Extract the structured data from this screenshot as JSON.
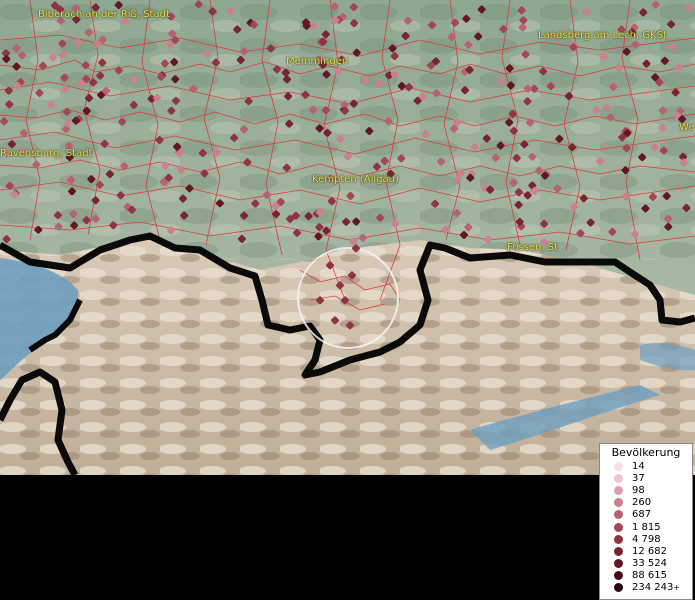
{
  "map": {
    "towns": [
      {
        "name": "Biberach an der Riß, Stadt"
      },
      {
        "name": "Memmingen"
      },
      {
        "name": "Landsberg am Lech, GKSt"
      },
      {
        "name": "Ravensburg, Stadt"
      },
      {
        "name": "Kempten (Allgäu)"
      },
      {
        "name": "Füssen, St"
      },
      {
        "name": "We"
      }
    ]
  },
  "legend": {
    "title": "Bevölkerung",
    "items": [
      {
        "label": "14",
        "color": "#f7dde8"
      },
      {
        "label": "37",
        "color": "#ecc4d2"
      },
      {
        "label": "98",
        "color": "#d9a0b0"
      },
      {
        "label": "260",
        "color": "#c9808f"
      },
      {
        "label": "687",
        "color": "#b66272"
      },
      {
        "label": "1 815",
        "color": "#a24756"
      },
      {
        "label": "4 798",
        "color": "#8e3443"
      },
      {
        "label": "12 682",
        "color": "#782532"
      },
      {
        "label": "33 524",
        "color": "#601826"
      },
      {
        "label": "88 615",
        "color": "#470e19"
      },
      {
        "label": "234 243",
        "color": "#2a060d",
        "suffix": "+"
      }
    ]
  }
}
